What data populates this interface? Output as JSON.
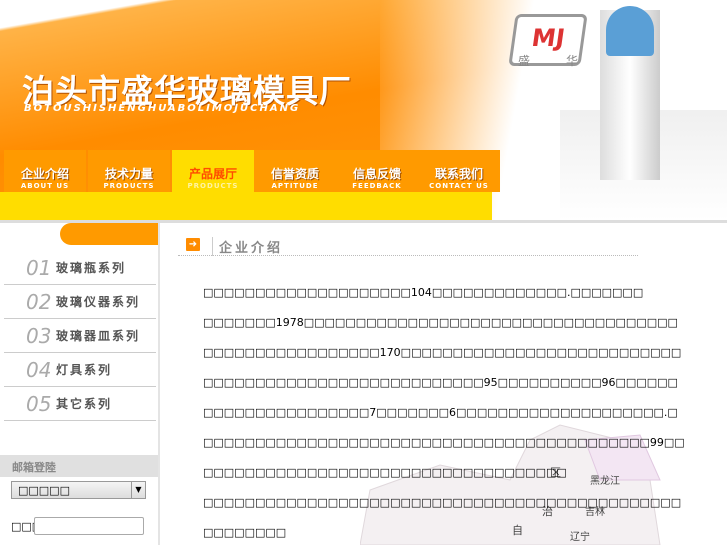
{
  "header": {
    "title": "泊头市盛华玻璃模具厂",
    "subtitle": "BOTOUSHISHENGHUABOLIMOJUCHANG",
    "logo": "MJ",
    "logo_chars": [
      "盛",
      "华"
    ]
  },
  "nav": [
    {
      "cn": "企业介绍",
      "en": "ABOUT US"
    },
    {
      "cn": "技术力量",
      "en": "PRODUCTS"
    },
    {
      "cn": "产品展厅",
      "en": "PRODUCTS"
    },
    {
      "cn": "信誉资质",
      "en": "APTITUDE"
    },
    {
      "cn": "信息反馈",
      "en": "FEEDBACK"
    },
    {
      "cn": "联系我们",
      "en": "CONTACT US"
    }
  ],
  "sidebar": {
    "items": [
      {
        "num": "01",
        "label": "玻璃瓶系列"
      },
      {
        "num": "02",
        "label": "玻璃仪器系列"
      },
      {
        "num": "03",
        "label": "玻璃器皿系列"
      },
      {
        "num": "04",
        "label": "灯具系列"
      },
      {
        "num": "05",
        "label": "其它系列"
      }
    ],
    "mail_title": "邮箱登陸",
    "mail_select": "□□□□□",
    "mail_user_label": "□□□"
  },
  "content": {
    "title": "企业介绍",
    "paragraphs": [
      "□□□□□□□□□□□□□□□□□□□□104□□□□□□□□□□□□□.□□□□□□□",
      "□□□□□□□1978□□□□□□□□□□□□□□□□□□□□□□□□□□□□□□□□□□□□□□□□□□□□□□□□□□□□□170□□□□□□□□□□□□□□□□□□□□□□□□□□□□□□□□□□□□□□□□□□□□□□□□□□□□□□95□□□□□□□□□□96□□□□□□□□□□□□□□□□□□□□□□7□□□□□□□6□□□□□□□□□□□□□□□□□□□□.□□□□□□□□□□□□□□□□□□□□□□□□□□□□□□□□□□□□□□□□□□□□99□□□□□□□□□□□□□□□□□□□□□□□□□□□□□□□□□□□□□",
      "□□□□□□□□□□□□□□□□□□□□□□□□□□□□□□□□□□□□□□□□□□□□□□□□□□□□□□"
    ]
  },
  "map": {
    "labels": [
      "区",
      "黑龙江",
      "治",
      "吉林",
      "自",
      "辽宁"
    ]
  }
}
